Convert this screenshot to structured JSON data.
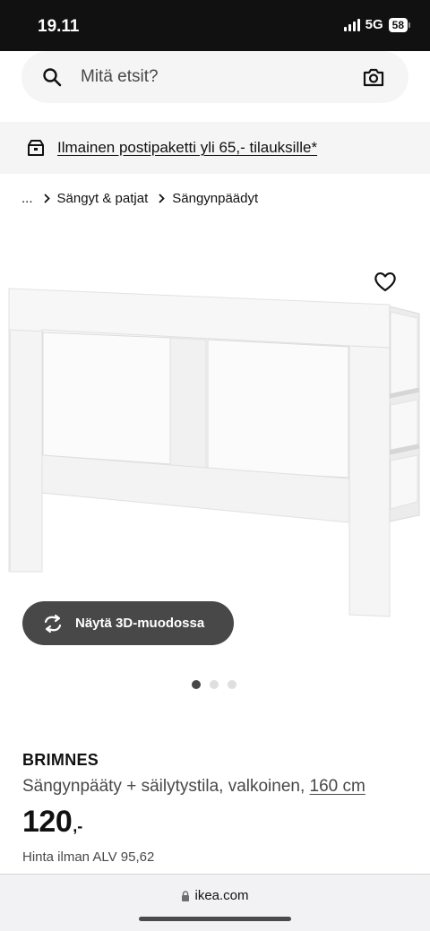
{
  "status_bar": {
    "time": "19.11",
    "network": "5G",
    "battery": "58"
  },
  "search": {
    "placeholder": "Mitä etsit?"
  },
  "promo": {
    "text": "Ilmainen postipaketti yli 65,- tilauksille*",
    "icon": "parcel-icon"
  },
  "breadcrumb": {
    "items": [
      "...",
      "Sängyt & patjat",
      "Sängynpäädyt"
    ]
  },
  "gallery": {
    "view_3d_label": "Näytä 3D-muodossa",
    "image_count": 3,
    "active_index": 0
  },
  "product": {
    "name": "BRIMNES",
    "description": "Sängynpääty + säilytystila, valkoinen, ",
    "size": "160 cm",
    "price": "120",
    "price_suffix": ",-",
    "price_vat": "Hinta ilman ALV 95,62"
  },
  "browser": {
    "url": "ikea.com"
  },
  "colors": {
    "accent_dark": "#484848",
    "background_gray": "#f5f5f5"
  }
}
